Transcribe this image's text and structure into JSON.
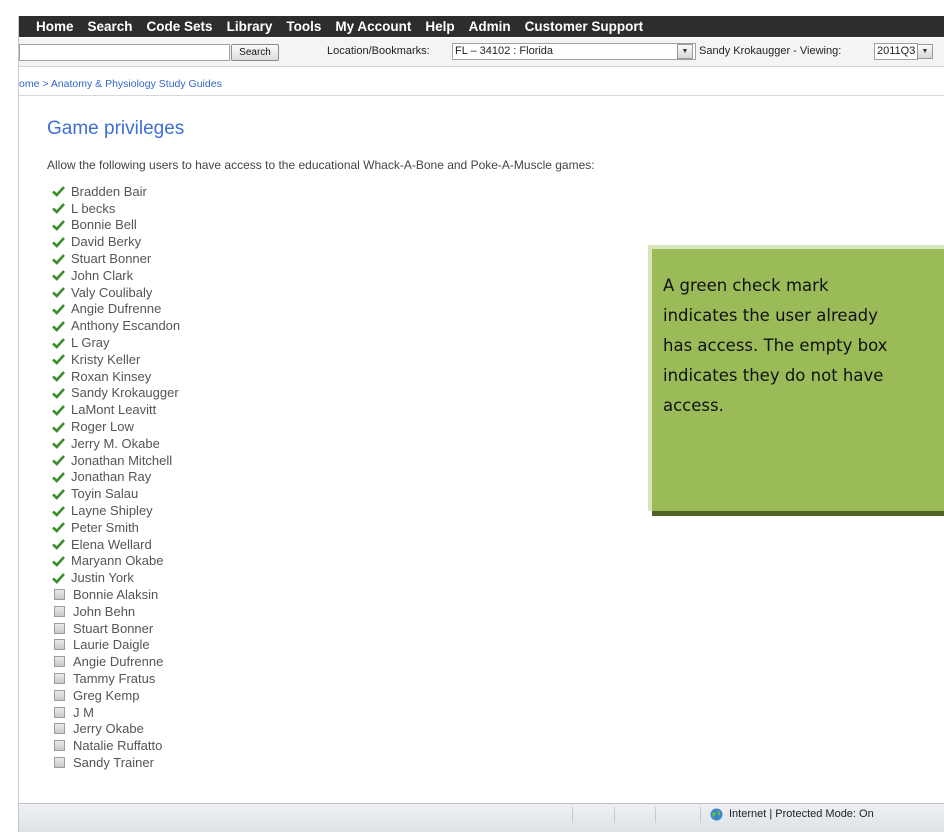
{
  "nav": {
    "items": [
      "Home",
      "Search",
      "Code Sets",
      "Library",
      "Tools",
      "My Account",
      "Help",
      "Admin",
      "Customer Support"
    ]
  },
  "searchbar": {
    "search_value": "",
    "search_button": "Search",
    "location_label": "Location/Bookmarks:",
    "location_value": "FL – 34102 : Florida",
    "user_label": "Sandy Krokaugger - Viewing:",
    "viewing_value": "2011Q3"
  },
  "breadcrumb": "ome > Anatomy & Physiology Study Guides",
  "page": {
    "title": "Game privileges",
    "description": "Allow the following users to have access to the educational Whack-A-Bone and Poke-A-Muscle games:"
  },
  "users_with_access": [
    "Bradden Bair",
    "L becks",
    "Bonnie Bell",
    "David Berky",
    "Stuart Bonner",
    "John Clark",
    "Valy Coulibaly",
    "Angie Dufrenne",
    "Anthony Escandon",
    "L Gray",
    "Kristy Keller",
    "Roxan Kinsey",
    "Sandy Krokaugger",
    "LaMont Leavitt",
    "Roger Low",
    "Jerry M. Okabe",
    "Jonathan Mitchell",
    "Jonathan Ray",
    "Toyin Salau",
    "Layne Shipley",
    "Peter Smith",
    "Elena Wellard",
    "Maryann Okabe",
    "Justin York"
  ],
  "users_without_access": [
    "Bonnie Alaksin",
    "John Behn",
    "Stuart Bonner",
    "Laurie Daigle",
    "Angie Dufrenne",
    "Tammy Fratus",
    "Greg Kemp",
    "J M",
    "Jerry Okabe",
    "Natalie Ruffatto",
    "Sandy Trainer"
  ],
  "callout": {
    "lines": [
      "A green check mark",
      "indicates the user already",
      "has access. The empty box",
      "indicates they do not have",
      "access."
    ]
  },
  "status": {
    "zone_text": "Internet | Protected Mode: On"
  },
  "colors": {
    "nav_bg": "#2d2d2d",
    "title": "#3d6fd4",
    "check": "#3a8f2c",
    "callout_bg": "#9bbb59",
    "callout_shadow": "#4e6128"
  },
  "icons": {
    "granted": "check-icon",
    "not_granted": "checkbox-icon",
    "zone": "globe-icon"
  }
}
